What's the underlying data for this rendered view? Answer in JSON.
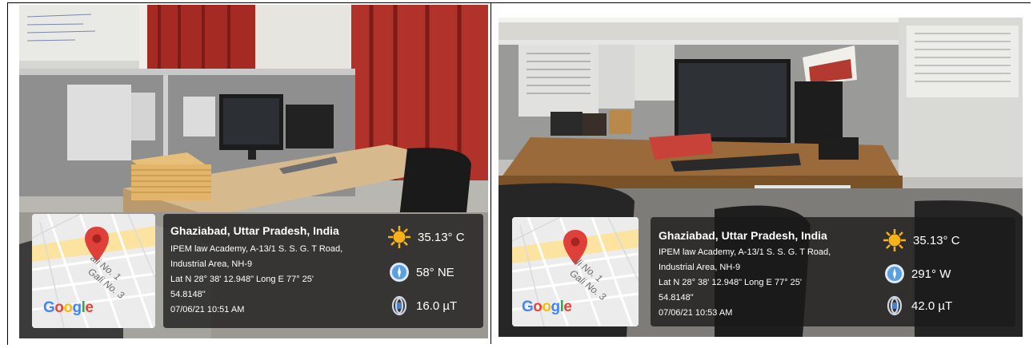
{
  "photos": [
    {
      "map": {
        "logo": "Google",
        "streets": [
          "ali No. 1",
          "Gali No. 3"
        ],
        "icon": "map-pin-icon"
      },
      "info": {
        "location": "Ghaziabad, Uttar Pradesh, India",
        "address_line1": "IPEM law Academy, A-13/1 S. S. G. T Road,",
        "address_line2": "Industrial Area, NH-9",
        "coords_line1": "Lat N 28° 38' 12.948\" Long E 77° 25'",
        "coords_line2": "54.8148\"",
        "datetime": "07/06/21 10:51 AM"
      },
      "metrics": {
        "temperature": "35.13° C",
        "direction": "58° NE",
        "magnetic": "16.0 µT"
      }
    },
    {
      "map": {
        "logo": "Google",
        "streets": [
          "ali No. 1",
          "Gali No. 3"
        ],
        "icon": "map-pin-icon"
      },
      "info": {
        "location": "Ghaziabad, Uttar Pradesh, India",
        "address_line1": "IPEM law Academy, A-13/1 S. S. G. T Road,",
        "address_line2": "Industrial Area, NH-9",
        "coords_line1": "Lat N 28° 38' 12.948\" Long E 77° 25'",
        "coords_line2": "54.8148\"",
        "datetime": "07/06/21 10:53 AM"
      },
      "metrics": {
        "temperature": "35.13° C",
        "direction": "291° W",
        "magnetic": "42.0 µT"
      }
    }
  ],
  "colors": {
    "overlay": "#191919",
    "pin": "#e0403a",
    "sun": "#f7b21b",
    "compass": "#5aa0e0"
  }
}
